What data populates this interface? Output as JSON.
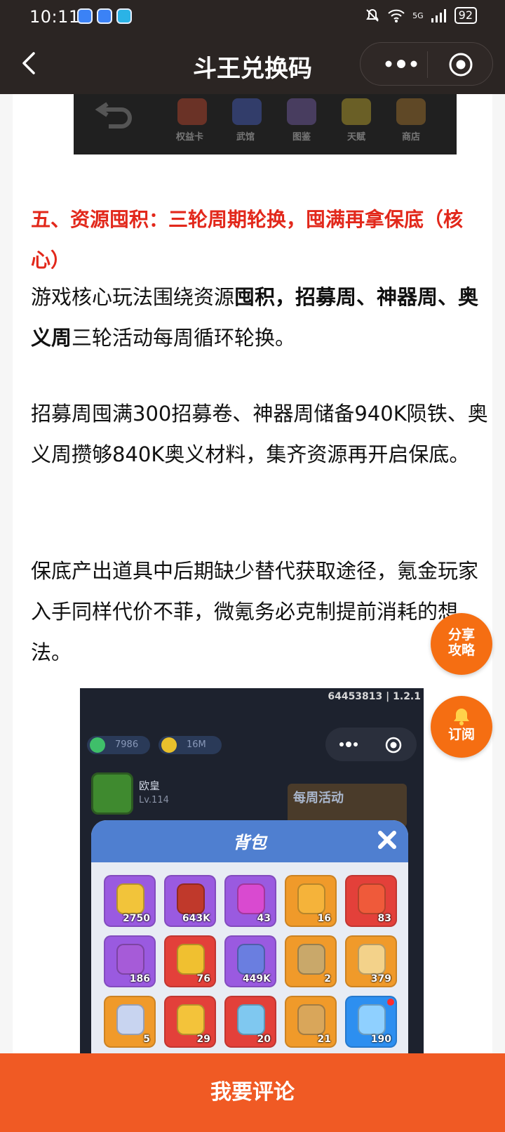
{
  "status": {
    "time": "10:11",
    "network": "5G",
    "battery": "92"
  },
  "header": {
    "title": "斗王兑换码"
  },
  "top_image": {
    "labels": [
      "权益卡",
      "武馆",
      "图鉴",
      "天赋",
      "商店"
    ]
  },
  "article": {
    "heading": "五、资源囤积：三轮周期轮换，囤满再拿保底（核心）",
    "p1_a": "游戏核心玩法围绕资源",
    "p1_b": "囤积，招募周、神器周、奥义周",
    "p1_c": "三轮活动每周循环轮换。",
    "p2": "招募周囤满300招募卷、神器周储备940K陨铁、奥义周攒够840K奥义材料，集齐资源再开启保底。",
    "p3": "保底产出道具中后期缺少替代获取途径，氪金玩家入手同样代价不菲，微氪务必克制提前消耗的想法。"
  },
  "screenshot": {
    "code": "64453813 | 1.2.1",
    "currency1": "7986",
    "currency2": "16M",
    "player_name": "欧皇",
    "player_level": "Lv.114",
    "weekly_label": "每周活动",
    "bag_title": "背包",
    "items": [
      {
        "count": "2750",
        "color": "purple"
      },
      {
        "count": "643K",
        "color": "purple"
      },
      {
        "count": "43",
        "color": "purple"
      },
      {
        "count": "16",
        "color": "orange"
      },
      {
        "count": "83",
        "color": "red"
      },
      {
        "count": "186",
        "color": "purple"
      },
      {
        "count": "76",
        "color": "red"
      },
      {
        "count": "449K",
        "color": "purple"
      },
      {
        "count": "2",
        "color": "orange"
      },
      {
        "count": "379",
        "color": "orange"
      },
      {
        "count": "5",
        "color": "orange"
      },
      {
        "count": "29",
        "color": "red"
      },
      {
        "count": "20",
        "color": "red"
      },
      {
        "count": "21",
        "color": "orange"
      },
      {
        "count": "190",
        "color": "blue"
      }
    ]
  },
  "fab": {
    "share": "分享攻略",
    "subscribe": "订阅"
  },
  "bottom": {
    "comment": "我要评论"
  }
}
